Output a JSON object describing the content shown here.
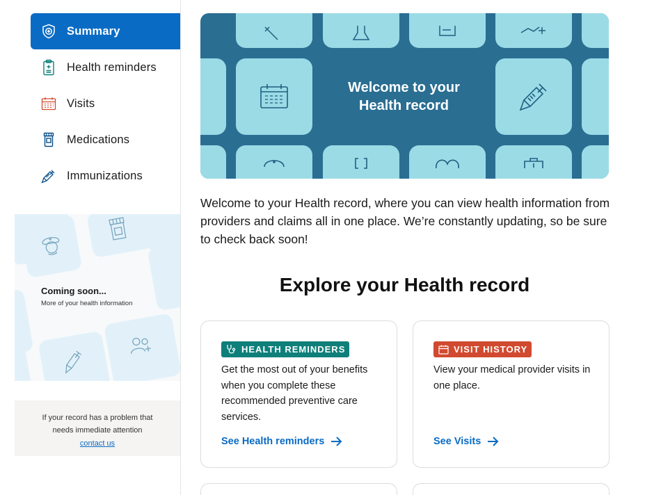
{
  "sidebar": {
    "items": [
      {
        "label": "Summary",
        "icon": "shield-plus-icon",
        "active": true
      },
      {
        "label": "Health reminders",
        "icon": "clipboard-icon",
        "active": false
      },
      {
        "label": "Visits",
        "icon": "calendar-icon",
        "active": false
      },
      {
        "label": "Medications",
        "icon": "pill-bottle-icon",
        "active": false
      },
      {
        "label": "Immunizations",
        "icon": "syringe-icon",
        "active": false
      }
    ],
    "coming_soon": {
      "title": "Coming soon...",
      "subtitle": "More of your health information"
    },
    "problem": {
      "line1": "If your record has a problem that",
      "line2": "needs immediate attention",
      "link": "contact us"
    }
  },
  "hero": {
    "line1": "Welcome to your",
    "line2": "Health record"
  },
  "intro": "Welcome to your Health record, where you can view health information from providers and claims all in one place. We’re constantly updating, so be sure to check back soon!",
  "section_title": "Explore your Health record",
  "cards": [
    {
      "badge": "HEALTH REMINDERS",
      "badge_color": "#0f7f7a",
      "badge_icon": "stethoscope-icon",
      "description": "Get the most out of your benefits when you complete these recommended preventive care services.",
      "link": "See Health reminders"
    },
    {
      "badge": "VISIT HISTORY",
      "badge_color": "#d14a2f",
      "badge_icon": "calendar-icon",
      "description": "View your medical provider visits in one place.",
      "link": "See Visits"
    }
  ],
  "colors": {
    "accent": "#0a6bc4",
    "hero_bg": "#2a6e92",
    "hero_tile": "#9bdbe6"
  }
}
